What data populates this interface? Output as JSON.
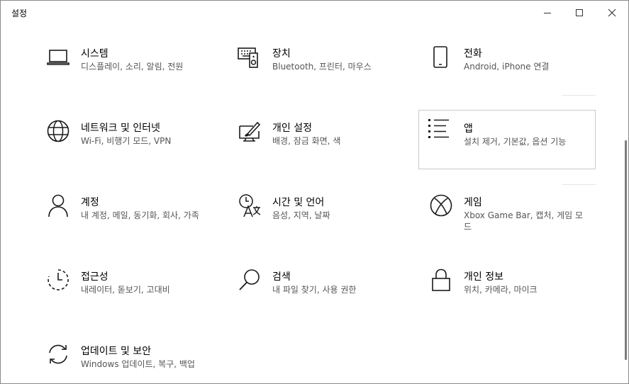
{
  "window": {
    "title": "설정"
  },
  "tiles": [
    {
      "name": "시스템",
      "desc": "디스플레이, 소리, 알림, 전원",
      "icon": "laptop-icon"
    },
    {
      "name": "장치",
      "desc": "Bluetooth, 프린터, 마우스",
      "icon": "devices-icon"
    },
    {
      "name": "전화",
      "desc": "Android, iPhone 연결",
      "icon": "phone-icon"
    },
    {
      "name": "네트워크 및 인터넷",
      "desc": "Wi-Fi, 비행기 모드, VPN",
      "icon": "globe-icon"
    },
    {
      "name": "개인 설정",
      "desc": "배경, 잠금 화면, 색",
      "icon": "personalization-icon"
    },
    {
      "name": "앱",
      "desc": "설치 제거, 기본값, 옵션 기능",
      "icon": "apps-list-icon"
    },
    {
      "name": "계정",
      "desc": "내 계정, 메일, 동기화, 회사, 가족",
      "icon": "person-icon"
    },
    {
      "name": "시간 및 언어",
      "desc": "음성, 지역, 날짜",
      "icon": "time-language-icon"
    },
    {
      "name": "게임",
      "desc": "Xbox Game Bar, 캡처, 게임 모드",
      "icon": "xbox-icon"
    },
    {
      "name": "접근성",
      "desc": "내레이터, 돋보기, 고대비",
      "icon": "accessibility-icon"
    },
    {
      "name": "검색",
      "desc": "내 파일 찾기, 사용 권한",
      "icon": "search-icon"
    },
    {
      "name": "개인 정보",
      "desc": "위치, 카메라, 마이크",
      "icon": "lock-icon"
    },
    {
      "name": "업데이트 및 보안",
      "desc": "Windows 업데이트, 복구, 백업",
      "icon": "sync-icon"
    }
  ]
}
